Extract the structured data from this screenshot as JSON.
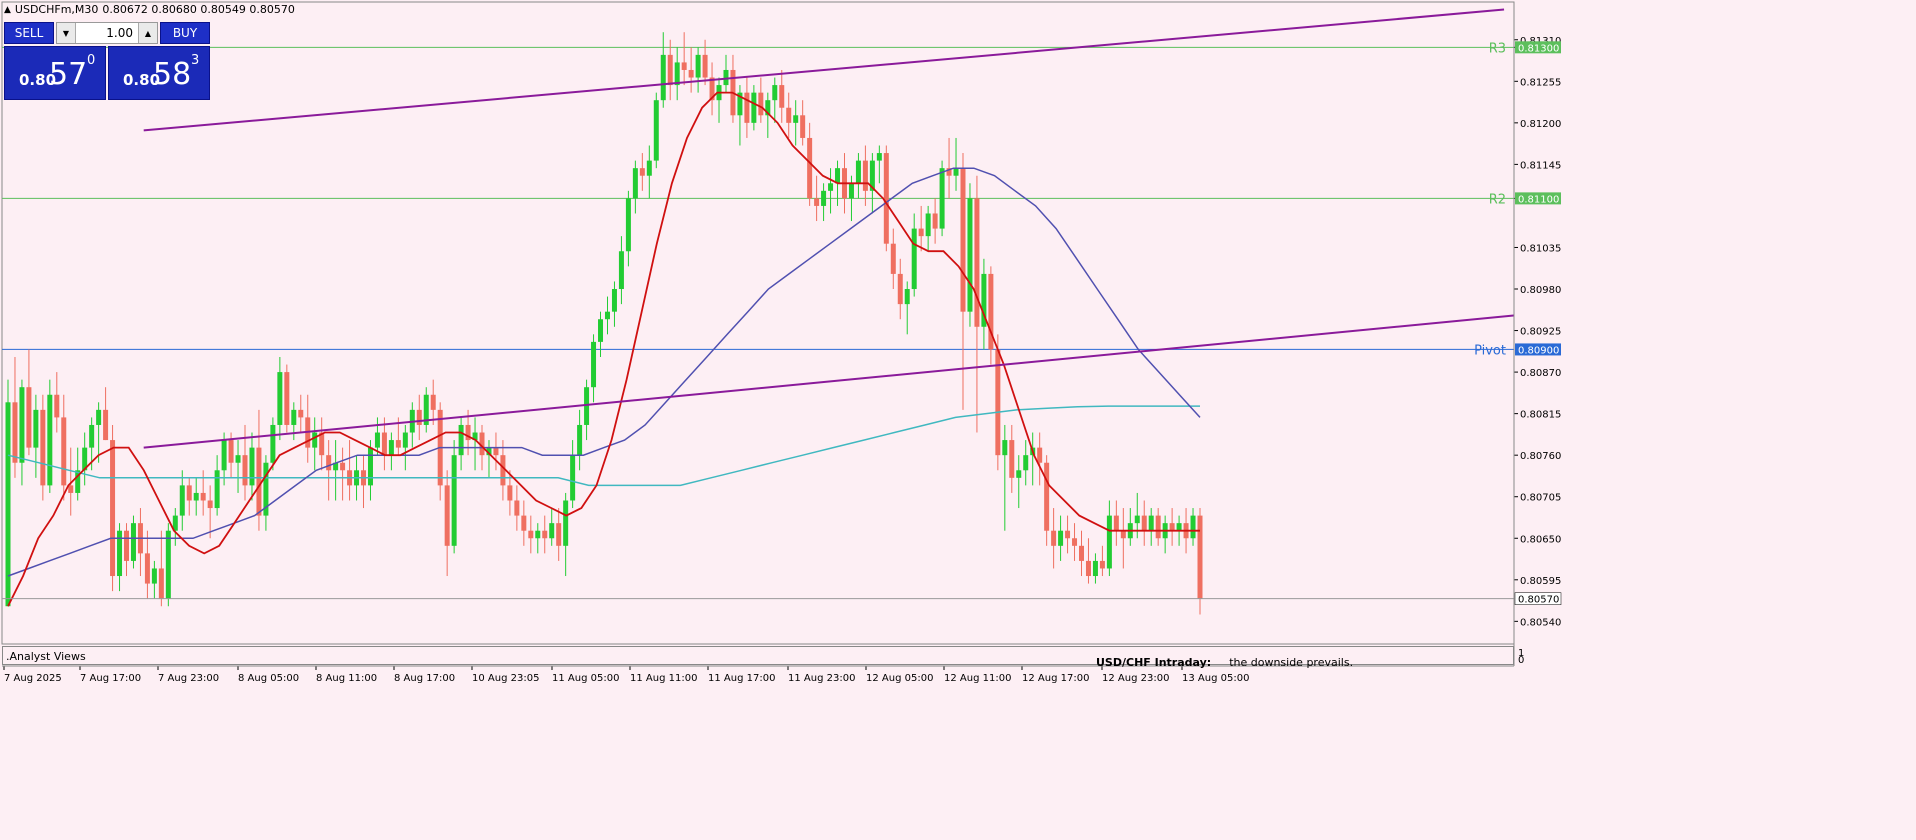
{
  "header": {
    "symbol": "USDCHFm,M30",
    "ohlc": "0.80672 0.80680 0.80549 0.80570",
    "menu_glyph": "▲"
  },
  "trade_panel": {
    "sell_label": "SELL",
    "buy_label": "BUY",
    "lot_value": "1.00",
    "lot_down_glyph": "▼",
    "lot_up_glyph": "▲",
    "sell_price": {
      "small": "0.80",
      "big": "57",
      "sup": "0"
    },
    "buy_price": {
      "small": "0.80",
      "big": "58",
      "sup": "3"
    }
  },
  "subwindow": {
    "label": ".Analyst Views",
    "scale_top": "1",
    "scale_bottom": "0",
    "note_title": "USD/CHF Intraday:",
    "note_text": "the downside prevails."
  },
  "chart_data": {
    "type": "candlestick",
    "ylim": [
      0.8051,
      0.8136
    ],
    "y_ticks": [
      0.8054,
      0.80595,
      0.8065,
      0.80705,
      0.8076,
      0.80815,
      0.8087,
      0.80925,
      0.8098,
      0.81035,
      0.811,
      0.81145,
      0.812,
      0.81255,
      0.813,
      0.8131
    ],
    "y_tick_labels": [
      "0.80540",
      "0.80595",
      "0.80650",
      "0.80705",
      "0.80760",
      "0.80815",
      "0.80870",
      "0.80925",
      "0.80980",
      "0.81035",
      "0.81100",
      "0.81145",
      "0.81200",
      "0.81255",
      "0.81300",
      "0.81310"
    ],
    "x_labels": [
      "7 Aug 2025",
      "7 Aug 17:00",
      "7 Aug 23:00",
      "8 Aug 05:00",
      "8 Aug 11:00",
      "8 Aug 17:00",
      "10 Aug 23:05",
      "11 Aug 05:00",
      "11 Aug 11:00",
      "11 Aug 17:00",
      "11 Aug 23:00",
      "12 Aug 05:00",
      "12 Aug 11:00",
      "12 Aug 17:00",
      "12 Aug 23:00",
      "13 Aug 05:00"
    ],
    "levels": [
      {
        "name": "R3",
        "value": 0.813,
        "color": "#5cbf5c",
        "label": "0.81300"
      },
      {
        "name": "R2",
        "value": 0.811,
        "color": "#5cbf5c",
        "label": "0.81100"
      },
      {
        "name": "Pivot",
        "value": 0.809,
        "color": "#2a6ad6",
        "label": "0.80900"
      }
    ],
    "current_price": {
      "value": 0.8057,
      "label": "0.80570"
    },
    "colors": {
      "bull": "#22cc33",
      "bear": "#ef6f60",
      "ma_fast": "#d01010",
      "ma_mid": "#5050b0",
      "ma_slow": "#40b8c0",
      "channel": "#8a1a9a"
    },
    "candles": [
      [
        0.8056,
        0.8086,
        0.8056,
        0.8083
      ],
      [
        0.8083,
        0.8089,
        0.8073,
        0.8075
      ],
      [
        0.8075,
        0.8086,
        0.8072,
        0.8085
      ],
      [
        0.8085,
        0.809,
        0.8076,
        0.8077
      ],
      [
        0.8077,
        0.8084,
        0.8073,
        0.8082
      ],
      [
        0.8082,
        0.8084,
        0.807,
        0.8072
      ],
      [
        0.8072,
        0.8086,
        0.8071,
        0.8084
      ],
      [
        0.8084,
        0.8087,
        0.8079,
        0.8081
      ],
      [
        0.8081,
        0.8084,
        0.807,
        0.8072
      ],
      [
        0.8072,
        0.8077,
        0.8068,
        0.8071
      ],
      [
        0.8071,
        0.8077,
        0.807,
        0.8074
      ],
      [
        0.8074,
        0.8079,
        0.8072,
        0.8077
      ],
      [
        0.8077,
        0.8081,
        0.8074,
        0.808
      ],
      [
        0.808,
        0.8083,
        0.8075,
        0.8082
      ],
      [
        0.8082,
        0.8085,
        0.8078,
        0.8078
      ],
      [
        0.8078,
        0.808,
        0.8058,
        0.806
      ],
      [
        0.806,
        0.8067,
        0.8058,
        0.8066
      ],
      [
        0.8066,
        0.8067,
        0.806,
        0.8062
      ],
      [
        0.8062,
        0.8068,
        0.8061,
        0.8067
      ],
      [
        0.8067,
        0.8069,
        0.806,
        0.8063
      ],
      [
        0.8063,
        0.8066,
        0.8057,
        0.8059
      ],
      [
        0.8059,
        0.8062,
        0.8057,
        0.8061
      ],
      [
        0.8061,
        0.8066,
        0.8056,
        0.8057
      ],
      [
        0.8057,
        0.8067,
        0.8056,
        0.8066
      ],
      [
        0.8066,
        0.8069,
        0.8064,
        0.8068
      ],
      [
        0.8068,
        0.8074,
        0.8066,
        0.8072
      ],
      [
        0.8072,
        0.8073,
        0.8068,
        0.807
      ],
      [
        0.807,
        0.8073,
        0.8068,
        0.8071
      ],
      [
        0.8071,
        0.8074,
        0.8068,
        0.807
      ],
      [
        0.807,
        0.8072,
        0.8065,
        0.8069
      ],
      [
        0.8069,
        0.8076,
        0.8068,
        0.8074
      ],
      [
        0.8074,
        0.8079,
        0.8072,
        0.8078
      ],
      [
        0.8078,
        0.8079,
        0.8073,
        0.8075
      ],
      [
        0.8075,
        0.8078,
        0.8071,
        0.8076
      ],
      [
        0.8076,
        0.808,
        0.807,
        0.8072
      ],
      [
        0.8072,
        0.8079,
        0.807,
        0.8077
      ],
      [
        0.8077,
        0.8082,
        0.8066,
        0.8068
      ],
      [
        0.8068,
        0.8076,
        0.8066,
        0.8075
      ],
      [
        0.8075,
        0.8081,
        0.8074,
        0.808
      ],
      [
        0.808,
        0.8089,
        0.8078,
        0.8087
      ],
      [
        0.8087,
        0.8088,
        0.8079,
        0.808
      ],
      [
        0.808,
        0.8083,
        0.8078,
        0.8082
      ],
      [
        0.8082,
        0.8084,
        0.8079,
        0.8081
      ],
      [
        0.8081,
        0.8084,
        0.8075,
        0.8077
      ],
      [
        0.8077,
        0.8081,
        0.8074,
        0.8079
      ],
      [
        0.8079,
        0.8081,
        0.8074,
        0.8076
      ],
      [
        0.8076,
        0.8078,
        0.807,
        0.8074
      ],
      [
        0.8074,
        0.8078,
        0.807,
        0.8075
      ],
      [
        0.8075,
        0.8077,
        0.807,
        0.8074
      ],
      [
        0.8074,
        0.8078,
        0.807,
        0.8072
      ],
      [
        0.8072,
        0.8076,
        0.807,
        0.8074
      ],
      [
        0.8074,
        0.8076,
        0.8069,
        0.8072
      ],
      [
        0.8072,
        0.8078,
        0.807,
        0.8077
      ],
      [
        0.8077,
        0.8081,
        0.8076,
        0.8079
      ],
      [
        0.8079,
        0.8081,
        0.8074,
        0.8076
      ],
      [
        0.8076,
        0.8079,
        0.8074,
        0.8078
      ],
      [
        0.8078,
        0.8081,
        0.8076,
        0.8077
      ],
      [
        0.8077,
        0.808,
        0.8074,
        0.8079
      ],
      [
        0.8079,
        0.8083,
        0.8077,
        0.8082
      ],
      [
        0.8082,
        0.8084,
        0.8078,
        0.808
      ],
      [
        0.808,
        0.8085,
        0.8079,
        0.8084
      ],
      [
        0.8084,
        0.8086,
        0.808,
        0.8082
      ],
      [
        0.8082,
        0.8083,
        0.807,
        0.8072
      ],
      [
        0.8072,
        0.8074,
        0.806,
        0.8064
      ],
      [
        0.8064,
        0.8078,
        0.8063,
        0.8076
      ],
      [
        0.8076,
        0.8081,
        0.8074,
        0.808
      ],
      [
        0.808,
        0.8082,
        0.8076,
        0.8078
      ],
      [
        0.8078,
        0.8081,
        0.8074,
        0.8079
      ],
      [
        0.8079,
        0.808,
        0.8074,
        0.8076
      ],
      [
        0.8076,
        0.8078,
        0.8073,
        0.8077
      ],
      [
        0.8077,
        0.8079,
        0.8074,
        0.8076
      ],
      [
        0.8076,
        0.8078,
        0.807,
        0.8072
      ],
      [
        0.8072,
        0.8074,
        0.8068,
        0.807
      ],
      [
        0.807,
        0.8072,
        0.8066,
        0.8068
      ],
      [
        0.8068,
        0.807,
        0.8064,
        0.8066
      ],
      [
        0.8066,
        0.8068,
        0.8063,
        0.8065
      ],
      [
        0.8065,
        0.8067,
        0.8063,
        0.8066
      ],
      [
        0.8066,
        0.8068,
        0.8063,
        0.8065
      ],
      [
        0.8065,
        0.8069,
        0.8064,
        0.8067
      ],
      [
        0.8067,
        0.8069,
        0.8062,
        0.8064
      ],
      [
        0.8064,
        0.8071,
        0.806,
        0.807
      ],
      [
        0.807,
        0.8078,
        0.8069,
        0.8076
      ],
      [
        0.8076,
        0.8082,
        0.8074,
        0.808
      ],
      [
        0.808,
        0.8086,
        0.8078,
        0.8085
      ],
      [
        0.8085,
        0.8092,
        0.8083,
        0.8091
      ],
      [
        0.8091,
        0.8095,
        0.8089,
        0.8094
      ],
      [
        0.8094,
        0.8097,
        0.8092,
        0.8095
      ],
      [
        0.8095,
        0.8099,
        0.8093,
        0.8098
      ],
      [
        0.8098,
        0.8105,
        0.8096,
        0.8103
      ],
      [
        0.8103,
        0.8111,
        0.8101,
        0.811
      ],
      [
        0.811,
        0.8115,
        0.8108,
        0.8114
      ],
      [
        0.8114,
        0.8116,
        0.8111,
        0.8113
      ],
      [
        0.8113,
        0.8117,
        0.811,
        0.8115
      ],
      [
        0.8115,
        0.8124,
        0.8114,
        0.8123
      ],
      [
        0.8123,
        0.8132,
        0.8122,
        0.8129
      ],
      [
        0.8129,
        0.8131,
        0.8123,
        0.8125
      ],
      [
        0.8125,
        0.813,
        0.8123,
        0.8128
      ],
      [
        0.8128,
        0.8132,
        0.8125,
        0.8127
      ],
      [
        0.8127,
        0.813,
        0.8124,
        0.8126
      ],
      [
        0.8126,
        0.813,
        0.8124,
        0.8129
      ],
      [
        0.8129,
        0.8131,
        0.8125,
        0.8126
      ],
      [
        0.8126,
        0.8128,
        0.8121,
        0.8123
      ],
      [
        0.8123,
        0.8126,
        0.812,
        0.8125
      ],
      [
        0.8125,
        0.8129,
        0.8124,
        0.8127
      ],
      [
        0.8127,
        0.8129,
        0.812,
        0.8121
      ],
      [
        0.8121,
        0.8125,
        0.8117,
        0.8124
      ],
      [
        0.8124,
        0.8126,
        0.8118,
        0.812
      ],
      [
        0.812,
        0.8125,
        0.8119,
        0.8124
      ],
      [
        0.8124,
        0.8126,
        0.812,
        0.8121
      ],
      [
        0.8121,
        0.8124,
        0.8118,
        0.8123
      ],
      [
        0.8123,
        0.8126,
        0.812,
        0.8125
      ],
      [
        0.8125,
        0.8127,
        0.812,
        0.8122
      ],
      [
        0.8122,
        0.8124,
        0.8118,
        0.812
      ],
      [
        0.812,
        0.8123,
        0.8117,
        0.8121
      ],
      [
        0.8121,
        0.8123,
        0.8117,
        0.8118
      ],
      [
        0.8118,
        0.812,
        0.8109,
        0.811
      ],
      [
        0.811,
        0.8113,
        0.8107,
        0.8109
      ],
      [
        0.8109,
        0.8112,
        0.8107,
        0.8111
      ],
      [
        0.8111,
        0.8114,
        0.8108,
        0.8112
      ],
      [
        0.8112,
        0.8115,
        0.8109,
        0.8114
      ],
      [
        0.8114,
        0.8116,
        0.8108,
        0.811
      ],
      [
        0.811,
        0.8113,
        0.8107,
        0.8112
      ],
      [
        0.8112,
        0.8116,
        0.811,
        0.8115
      ],
      [
        0.8115,
        0.8117,
        0.8109,
        0.8111
      ],
      [
        0.8111,
        0.8116,
        0.8108,
        0.8115
      ],
      [
        0.8115,
        0.8117,
        0.8112,
        0.8116
      ],
      [
        0.8116,
        0.8117,
        0.8103,
        0.8104
      ],
      [
        0.8104,
        0.8106,
        0.8098,
        0.81
      ],
      [
        0.81,
        0.8102,
        0.8094,
        0.8096
      ],
      [
        0.8096,
        0.8099,
        0.8092,
        0.8098
      ],
      [
        0.8098,
        0.8108,
        0.8097,
        0.8106
      ],
      [
        0.8106,
        0.8109,
        0.8103,
        0.8105
      ],
      [
        0.8105,
        0.8109,
        0.8103,
        0.8108
      ],
      [
        0.8108,
        0.811,
        0.8104,
        0.8106
      ],
      [
        0.8106,
        0.8115,
        0.8105,
        0.8114
      ],
      [
        0.8114,
        0.8118,
        0.811,
        0.8113
      ],
      [
        0.8113,
        0.8118,
        0.8111,
        0.8114
      ],
      [
        0.8114,
        0.8116,
        0.8082,
        0.8095
      ],
      [
        0.8095,
        0.8112,
        0.8093,
        0.811
      ],
      [
        0.811,
        0.8113,
        0.8079,
        0.8093
      ],
      [
        0.8093,
        0.8102,
        0.809,
        0.81
      ],
      [
        0.81,
        0.8101,
        0.8088,
        0.809
      ],
      [
        0.809,
        0.8092,
        0.8074,
        0.8076
      ],
      [
        0.8076,
        0.808,
        0.8066,
        0.8078
      ],
      [
        0.8078,
        0.808,
        0.8071,
        0.8073
      ],
      [
        0.8073,
        0.8076,
        0.8069,
        0.8074
      ],
      [
        0.8074,
        0.8078,
        0.8072,
        0.8076
      ],
      [
        0.8076,
        0.8079,
        0.8072,
        0.8077
      ],
      [
        0.8077,
        0.8079,
        0.8072,
        0.8075
      ],
      [
        0.8075,
        0.8076,
        0.8064,
        0.8066
      ],
      [
        0.8066,
        0.8069,
        0.8061,
        0.8064
      ],
      [
        0.8064,
        0.8068,
        0.8062,
        0.8066
      ],
      [
        0.8066,
        0.8068,
        0.8063,
        0.8065
      ],
      [
        0.8065,
        0.8067,
        0.8062,
        0.8064
      ],
      [
        0.8064,
        0.8066,
        0.806,
        0.8062
      ],
      [
        0.8062,
        0.8065,
        0.8059,
        0.806
      ],
      [
        0.806,
        0.8063,
        0.8059,
        0.8062
      ],
      [
        0.8062,
        0.8064,
        0.806,
        0.8061
      ],
      [
        0.8061,
        0.807,
        0.806,
        0.8068
      ],
      [
        0.8068,
        0.807,
        0.8064,
        0.8066
      ],
      [
        0.8066,
        0.8069,
        0.8061,
        0.8065
      ],
      [
        0.8065,
        0.8069,
        0.8064,
        0.8067
      ],
      [
        0.8067,
        0.8071,
        0.8065,
        0.8068
      ],
      [
        0.8068,
        0.807,
        0.8064,
        0.8066
      ],
      [
        0.8066,
        0.8069,
        0.8064,
        0.8068
      ],
      [
        0.8068,
        0.8069,
        0.8064,
        0.8065
      ],
      [
        0.8065,
        0.8068,
        0.8063,
        0.8067
      ],
      [
        0.8067,
        0.8069,
        0.8064,
        0.8066
      ],
      [
        0.8066,
        0.8068,
        0.8064,
        0.8067
      ],
      [
        0.8067,
        0.8069,
        0.8063,
        0.8065
      ],
      [
        0.8065,
        0.8069,
        0.8064,
        0.8068
      ],
      [
        0.8068,
        0.8069,
        0.80549,
        0.8057
      ]
    ],
    "ma_fast": [
      0.8056,
      0.806,
      0.8065,
      0.8068,
      0.8072,
      0.8074,
      0.8076,
      0.8077,
      0.8077,
      0.8074,
      0.807,
      0.8066,
      0.8064,
      0.8063,
      0.8064,
      0.8067,
      0.807,
      0.8073,
      0.8076,
      0.8077,
      0.8078,
      0.8079,
      0.8079,
      0.8078,
      0.8077,
      0.8076,
      0.8076,
      0.8077,
      0.8078,
      0.8079,
      0.8079,
      0.8078,
      0.8076,
      0.8074,
      0.8072,
      0.807,
      0.8069,
      0.8068,
      0.8069,
      0.8072,
      0.8078,
      0.8086,
      0.8095,
      0.8104,
      0.8112,
      0.8118,
      0.8122,
      0.8124,
      0.8124,
      0.8123,
      0.8122,
      0.812,
      0.8117,
      0.8115,
      0.8113,
      0.8112,
      0.8112,
      0.8112,
      0.811,
      0.8107,
      0.8104,
      0.8103,
      0.8103,
      0.8101,
      0.8098,
      0.8093,
      0.8088,
      0.8082,
      0.8076,
      0.8072,
      0.807,
      0.8068,
      0.8067,
      0.8066,
      0.8066,
      0.8066,
      0.8066,
      0.8066,
      0.8066,
      0.8066
    ],
    "ma_mid": [
      0.806,
      0.8061,
      0.8062,
      0.8063,
      0.8064,
      0.8065,
      0.8065,
      0.8065,
      0.8065,
      0.8065,
      0.8066,
      0.8067,
      0.8068,
      0.807,
      0.8072,
      0.8074,
      0.8075,
      0.8076,
      0.8076,
      0.8076,
      0.8076,
      0.8077,
      0.8077,
      0.8077,
      0.8077,
      0.8077,
      0.8076,
      0.8076,
      0.8076,
      0.8077,
      0.8078,
      0.808,
      0.8083,
      0.8086,
      0.8089,
      0.8092,
      0.8095,
      0.8098,
      0.81,
      0.8102,
      0.8104,
      0.8106,
      0.8108,
      0.811,
      0.8112,
      0.8113,
      0.8114,
      0.8114,
      0.8113,
      0.8111,
      0.8109,
      0.8106,
      0.8102,
      0.8098,
      0.8094,
      0.809,
      0.8087,
      0.8084,
      0.8081
    ],
    "ma_slow": [
      0.8076,
      0.8075,
      0.8074,
      0.8073,
      0.8073,
      0.8073,
      0.8073,
      0.8073,
      0.8073,
      0.8073,
      0.8073,
      0.8073,
      0.8073,
      0.8073,
      0.8073,
      0.8073,
      0.8073,
      0.8073,
      0.8073,
      0.8072,
      0.8072,
      0.8072,
      0.8072,
      0.8073,
      0.8074,
      0.8075,
      0.8076,
      0.8077,
      0.8078,
      0.8079,
      0.808,
      0.8081,
      0.80815,
      0.8082,
      0.80822,
      0.80824,
      0.80825,
      0.80825,
      0.80825,
      0.80825
    ],
    "channel_upper": [
      {
        "x": 0.075,
        "y": 0.8119
      },
      {
        "x": 0.785,
        "y": 0.8135
      }
    ],
    "channel_lower": [
      {
        "x": 0.075,
        "y": 0.8077
      },
      {
        "x": 0.79,
        "y": 0.80945
      }
    ]
  }
}
